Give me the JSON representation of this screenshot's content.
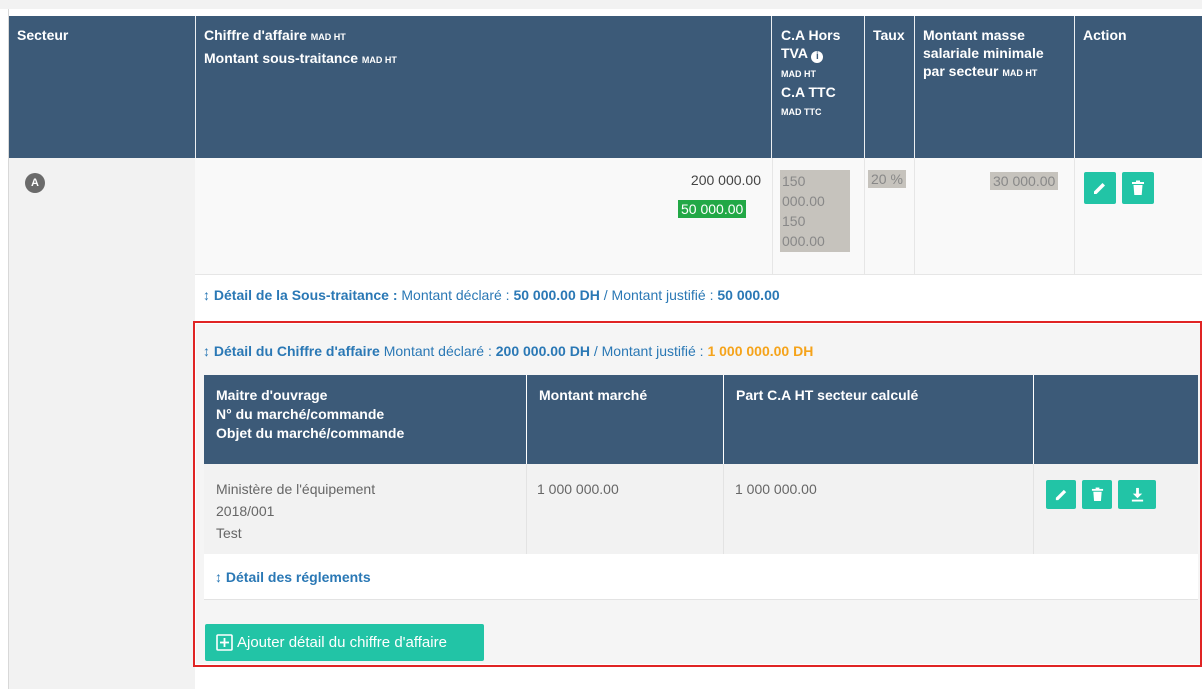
{
  "header": {
    "secteur": "Secteur",
    "ca_label": "Chiffre d'affaire",
    "ca_unit": "MAD HT",
    "st_label": "Montant sous-traitance",
    "st_unit": "MAD HT",
    "cahors_label1": "C.A Hors",
    "cahors_label2": "TVA",
    "cahors_unit": "MAD HT",
    "cattc_label": "C.A TTC",
    "cattc_unit": "MAD TTC",
    "taux": "Taux",
    "masse_line1": "Montant masse",
    "masse_line2": "salariale minimale",
    "masse_line3": "par secteur",
    "masse_unit": "MAD HT",
    "action": "Action"
  },
  "row": {
    "secteur_badge": "A",
    "chiffre_affaire": "200 000.00",
    "sous_traitance": "50 000.00",
    "ca_hors_tva_1": "150",
    "ca_hors_tva_2": "000.00",
    "ca_ttc_1": "150",
    "ca_ttc_2": "000.00",
    "taux": "20 %",
    "masse": "30 000.00"
  },
  "detail_st": {
    "title": "Détail de la Sous-traitance :",
    "declared_label": "Montant déclaré :",
    "declared_value": "50 000.00 DH",
    "separator": "/",
    "justified_label": "Montant justifié :",
    "justified_value": "50 000.00"
  },
  "detail_ca": {
    "title": "Détail du Chiffre d'affaire",
    "declared_label": "Montant déclaré :",
    "declared_value": "200 000.00 DH",
    "separator": "/",
    "justified_label": "Montant justifié :",
    "justified_value": "1 000 000.00 DH"
  },
  "sub_table": {
    "headers": {
      "col1_line1": "Maitre d'ouvrage",
      "col1_line2": "N° du marché/commande",
      "col1_line3": "Objet du marché/commande",
      "col2": "Montant marché",
      "col3": "Part C.A HT secteur calculé"
    },
    "rows": [
      {
        "maitre": "Ministère de l'équipement",
        "numero": "2018/001",
        "objet": "Test",
        "montant": "1 000 000.00",
        "part": "1 000 000.00"
      }
    ],
    "reglements_link": "Détail des réglements"
  },
  "add_button": "Ajouter détail du chiffre d'affaire",
  "colors": {
    "header_bg": "#3c5a78",
    "action_green": "#22c4a6",
    "highlight_green": "#22a846",
    "link_blue": "#2a78b5",
    "warning_orange": "#f5a31a",
    "border_red": "#e02424"
  }
}
